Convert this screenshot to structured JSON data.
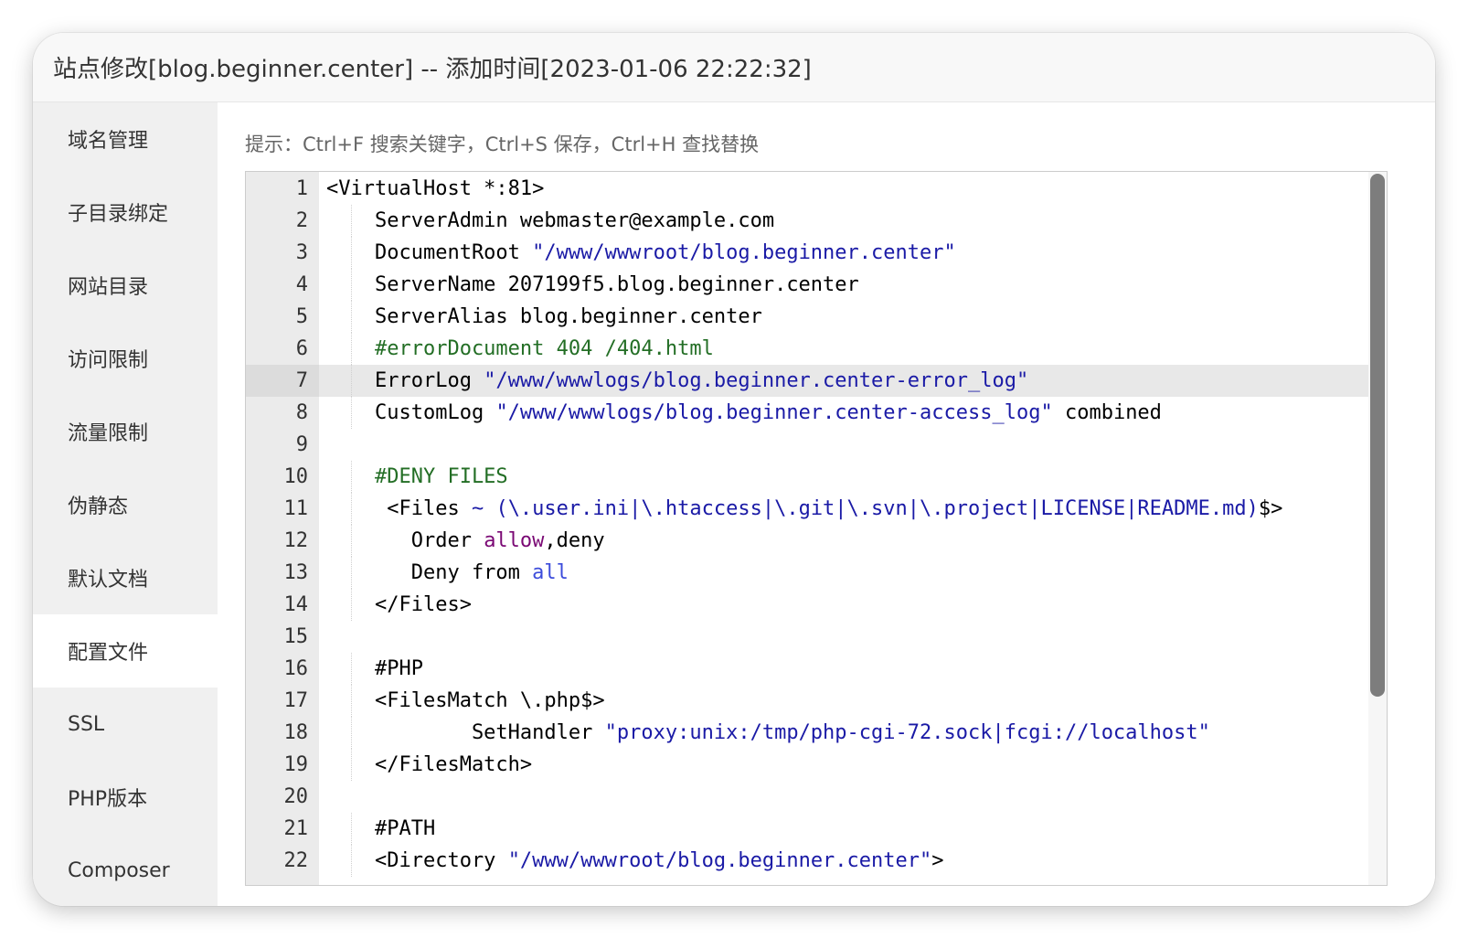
{
  "dialog": {
    "title": "站点修改[blog.beginner.center] -- 添加时间[2023-01-06 22:22:32]"
  },
  "sidebar": {
    "items": [
      {
        "label": "域名管理"
      },
      {
        "label": "子目录绑定"
      },
      {
        "label": "网站目录"
      },
      {
        "label": "访问限制"
      },
      {
        "label": "流量限制"
      },
      {
        "label": "伪静态"
      },
      {
        "label": "默认文档"
      },
      {
        "label": "配置文件",
        "active": true
      },
      {
        "label": "SSL"
      },
      {
        "label": "PHP版本"
      },
      {
        "label": "Composer"
      }
    ]
  },
  "hint": "提示：Ctrl+F 搜索关键字，Ctrl+S 保存，Ctrl+H 查找替换",
  "editor": {
    "active_line": 7,
    "lines": [
      {
        "n": "1",
        "segs": [
          {
            "t": "<VirtualHost *:81>"
          }
        ]
      },
      {
        "n": "2",
        "segs": [
          {
            "t": "    ServerAdmin webmaster@example.com"
          }
        ]
      },
      {
        "n": "3",
        "segs": [
          {
            "t": "    DocumentRoot "
          },
          {
            "t": "\"/www/wwwroot/blog.beginner.center\"",
            "c": "s-str"
          }
        ]
      },
      {
        "n": "4",
        "segs": [
          {
            "t": "    ServerName 207199f5.blog.beginner.center"
          }
        ]
      },
      {
        "n": "5",
        "segs": [
          {
            "t": "    ServerAlias blog.beginner.center"
          }
        ]
      },
      {
        "n": "6",
        "segs": [
          {
            "t": "    #errorDocument 404 /404.html",
            "c": "s-com"
          }
        ]
      },
      {
        "n": "7",
        "segs": [
          {
            "t": "    ErrorLog "
          },
          {
            "t": "\"/www/wwwlogs/blog.beginner.center-error_log\"",
            "c": "s-str"
          }
        ]
      },
      {
        "n": "8",
        "segs": [
          {
            "t": "    CustomLog "
          },
          {
            "t": "\"/www/wwwlogs/blog.beginner.center-access_log\"",
            "c": "s-str"
          },
          {
            "t": " combined"
          }
        ]
      },
      {
        "n": "9",
        "segs": [
          {
            "t": ""
          }
        ]
      },
      {
        "n": "10",
        "segs": [
          {
            "t": "    #DENY FILES",
            "c": "s-com"
          }
        ]
      },
      {
        "n": "11",
        "segs": [
          {
            "t": "     <Files "
          },
          {
            "t": "~ (\\.user.ini|\\.htaccess|\\.git|\\.svn|\\.project|LICENSE|README.md)",
            "c": "s-str"
          },
          {
            "t": "$>"
          }
        ]
      },
      {
        "n": "12",
        "segs": [
          {
            "t": "       Order "
          },
          {
            "t": "allow",
            "c": "s-kw"
          },
          {
            "t": ",deny"
          }
        ]
      },
      {
        "n": "13",
        "segs": [
          {
            "t": "       Deny from "
          },
          {
            "t": "all",
            "c": "s-kw2"
          }
        ]
      },
      {
        "n": "14",
        "segs": [
          {
            "t": "    </Files>"
          }
        ]
      },
      {
        "n": "15",
        "segs": [
          {
            "t": ""
          }
        ]
      },
      {
        "n": "16",
        "segs": [
          {
            "t": "    #PHP"
          }
        ]
      },
      {
        "n": "17",
        "segs": [
          {
            "t": "    <FilesMatch \\.php$>"
          }
        ]
      },
      {
        "n": "18",
        "segs": [
          {
            "t": "            SetHandler "
          },
          {
            "t": "\"proxy:unix:/tmp/php-cgi-72.sock|fcgi://localhost\"",
            "c": "s-str"
          }
        ]
      },
      {
        "n": "19",
        "segs": [
          {
            "t": "    </FilesMatch>"
          }
        ]
      },
      {
        "n": "20",
        "segs": [
          {
            "t": ""
          }
        ]
      },
      {
        "n": "21",
        "segs": [
          {
            "t": "    #PATH"
          }
        ]
      },
      {
        "n": "22",
        "segs": [
          {
            "t": "    <Directory "
          },
          {
            "t": "\"/www/wwwroot/blog.beginner.center\"",
            "c": "s-str"
          },
          {
            "t": ">"
          }
        ]
      }
    ]
  }
}
